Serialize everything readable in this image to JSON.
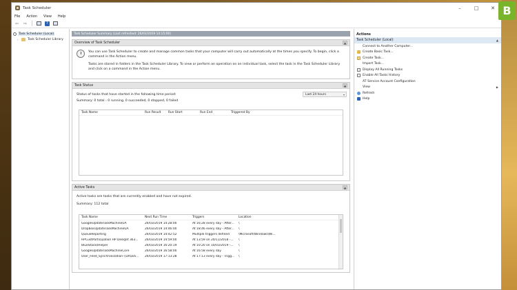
{
  "window": {
    "title": "Task Scheduler",
    "controls": [
      "–",
      "□",
      "✕"
    ]
  },
  "menu": [
    "File",
    "Action",
    "View",
    "Help"
  ],
  "toolbar": {
    "icons": [
      "back-arrow-icon",
      "forward-arrow-icon",
      "console-tree-icon",
      "help-icon",
      "properties-pane-icon"
    ],
    "back": "⇦",
    "forward": "⇨",
    "help": "?"
  },
  "tree": {
    "root": "Task Scheduler (Local)",
    "child": "Task Scheduler Library"
  },
  "center": {
    "header": "Task Scheduler Summary (Last refreshed: 26/03/2019 14:15:00)",
    "overview": {
      "title": "Overview of Task Scheduler",
      "p1": "You can use Task Scheduler to create and manage common tasks that your computer will carry out automatically at the times you specify. To begin, click a command in the Action menu.",
      "p2": "Tasks are stored in folders in the Task Scheduler Library. To view or perform an operation on an individual task, select the task in the Task Scheduler Library and click on a command in the Action menu."
    },
    "task_status": {
      "title": "Task Status",
      "status_line": "Status of tasks that have started in the following time period:",
      "period": "Last 24 hours",
      "summary": "Summary: 0 total - 0 running, 0 succeeded, 0 stopped, 0 failed",
      "columns": [
        "Task Name",
        "Run Result",
        "Run Start",
        "Run End",
        "Triggered By"
      ]
    },
    "active_tasks": {
      "title": "Active Tasks",
      "description": "Active tasks are tasks that are currently enabled and have not expired.",
      "summary": "Summary: 112 total",
      "columns": [
        "Task Name",
        "Next Run Time",
        "Triggers",
        "Location"
      ],
      "rows": [
        [
          "GoogleUpdateTaskMachineUA",
          "26/03/2019 14:28:00",
          "At 16:28 every day - After...",
          "\\"
        ],
        [
          "DropboxUpdateTaskMachineUA",
          "26/03/2019 14:46:00",
          "At 18:46 every day - After...",
          "\\"
        ],
        [
          "QueueReporting",
          "26/03/2019 14:42:52",
          "Multiple triggers defined",
          "\\Microsoft\\Windows\\Wi..."
        ],
        [
          "HPCustParticipation HP DeskJet 363...",
          "26/03/2019 14:59:00",
          "At 13:59 on 20/11/2018 -...",
          "\\"
        ],
        [
          "BlueStacksHelper",
          "26/03/2019 16:20:19",
          "At 10:20 on 10/03/2019 -...",
          "\\"
        ],
        [
          "GoogleUpdateTaskMachineCore",
          "26/03/2019 16:58:00",
          "At 16:58 every day",
          "\\"
        ],
        [
          "User_Feed_Synchronization-{DA5E6...",
          "26/03/2019 17:13:28",
          "At 17:13 every day - Trigg...",
          "\\"
        ]
      ]
    }
  },
  "actions": {
    "title": "Actions",
    "group": "Task Scheduler (Local)",
    "items": [
      "Connect to Another Computer...",
      "Create Basic Task...",
      "Create Task...",
      "Import Task...",
      "Display All Running Tasks",
      "Enable All Tasks History",
      "AT Service Account Configuration",
      "View",
      "Refresh",
      "Help"
    ]
  },
  "badge": "B",
  "colors": {
    "action_group_bg": "#dde8f5",
    "section_header_bg": "#e4e4e4",
    "center_header_bg": "#9aa3ad",
    "badge": "#79b52b"
  }
}
